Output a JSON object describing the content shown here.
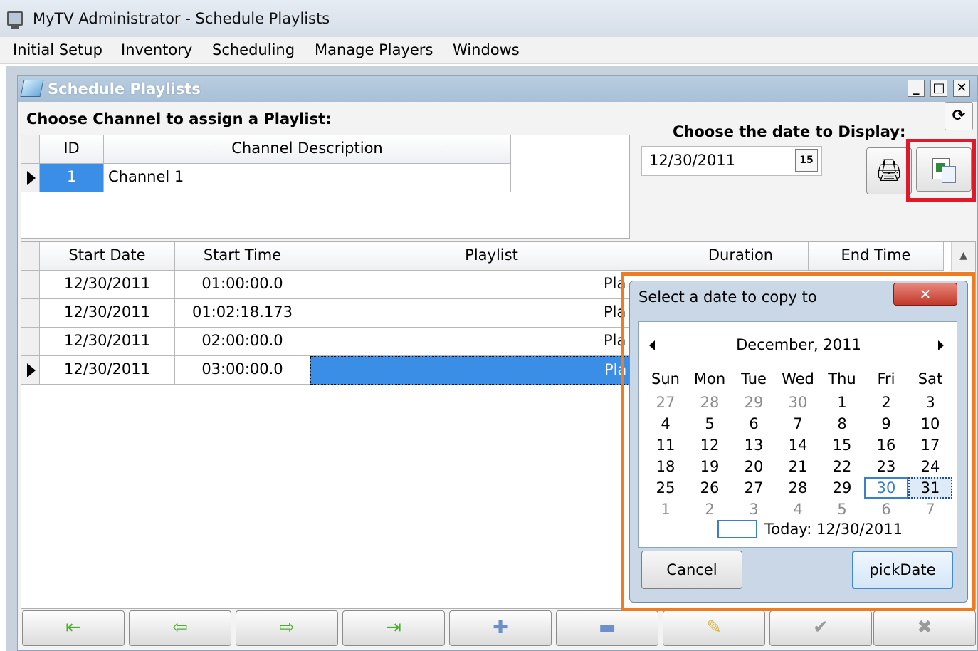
{
  "app": {
    "title": "MyTV Administrator - Schedule Playlists"
  },
  "menu": [
    "Initial Setup",
    "Inventory",
    "Scheduling",
    "Manage Players",
    "Windows"
  ],
  "child_window": {
    "title": "Schedule Playlists",
    "buttons": {
      "minimize": "_",
      "maximize": "□",
      "close": "✕"
    }
  },
  "channel": {
    "label": "Choose Channel to assign a Playlist:",
    "columns": [
      "ID",
      "Channel Description"
    ],
    "rows": [
      {
        "id": "1",
        "description": "Channel 1"
      }
    ]
  },
  "date_display": {
    "label": "Choose the date to Display:",
    "value": "12/30/2011",
    "calendar_button": "15"
  },
  "schedule": {
    "columns": [
      "Start Date",
      "Start Time",
      "Playlist",
      "Duration",
      "End Time"
    ],
    "rows": [
      {
        "start_date": "12/30/2011",
        "start_time": "01:00:00.0",
        "playlist": "Pla"
      },
      {
        "start_date": "12/30/2011",
        "start_time": "01:02:18.173",
        "playlist": "Pla"
      },
      {
        "start_date": "12/30/2011",
        "start_time": "02:00:00.0",
        "playlist": "Pla"
      },
      {
        "start_date": "12/30/2011",
        "start_time": "03:00:00.0",
        "playlist": "Pla"
      }
    ]
  },
  "toolbar": {
    "buttons": [
      {
        "name": "first-record",
        "glyph": "⇤"
      },
      {
        "name": "previous-record",
        "glyph": "⇦"
      },
      {
        "name": "next-record",
        "glyph": "⇨"
      },
      {
        "name": "last-record",
        "glyph": "⇥"
      },
      {
        "name": "add-record",
        "glyph": "✚"
      },
      {
        "name": "delete-record",
        "glyph": "▬"
      },
      {
        "name": "edit-record",
        "glyph": "✎"
      },
      {
        "name": "confirm",
        "glyph": "✔"
      },
      {
        "name": "cancel-edit",
        "glyph": "✖"
      }
    ],
    "colors": {
      "nav": "#4caf2a",
      "action": "#6c8ec9",
      "edit": "#d9b340",
      "disabled": "#9a9a9a"
    }
  },
  "dialog": {
    "title": "Select a date to copy to",
    "close": "✕",
    "calendar": {
      "month": "December, 2011",
      "weekdays": [
        "Sun",
        "Mon",
        "Tue",
        "Wed",
        "Thu",
        "Fri",
        "Sat"
      ],
      "weeks": [
        [
          "27",
          "28",
          "29",
          "30",
          "1",
          "2",
          "3"
        ],
        [
          "4",
          "5",
          "6",
          "7",
          "8",
          "9",
          "10"
        ],
        [
          "11",
          "12",
          "13",
          "14",
          "15",
          "16",
          "17"
        ],
        [
          "18",
          "19",
          "20",
          "21",
          "22",
          "23",
          "24"
        ],
        [
          "25",
          "26",
          "27",
          "28",
          "29",
          "30",
          "31"
        ],
        [
          "1",
          "2",
          "3",
          "4",
          "5",
          "6",
          "7"
        ]
      ],
      "today": "30",
      "selected": "31",
      "today_label": "Today: 12/30/2011"
    },
    "cancel_label": "Cancel",
    "pick_label": "pickDate"
  },
  "colors": {
    "highlight_red": "#e0192a",
    "highlight_orange": "#f07c22",
    "selection_blue": "#3a8ee6"
  }
}
